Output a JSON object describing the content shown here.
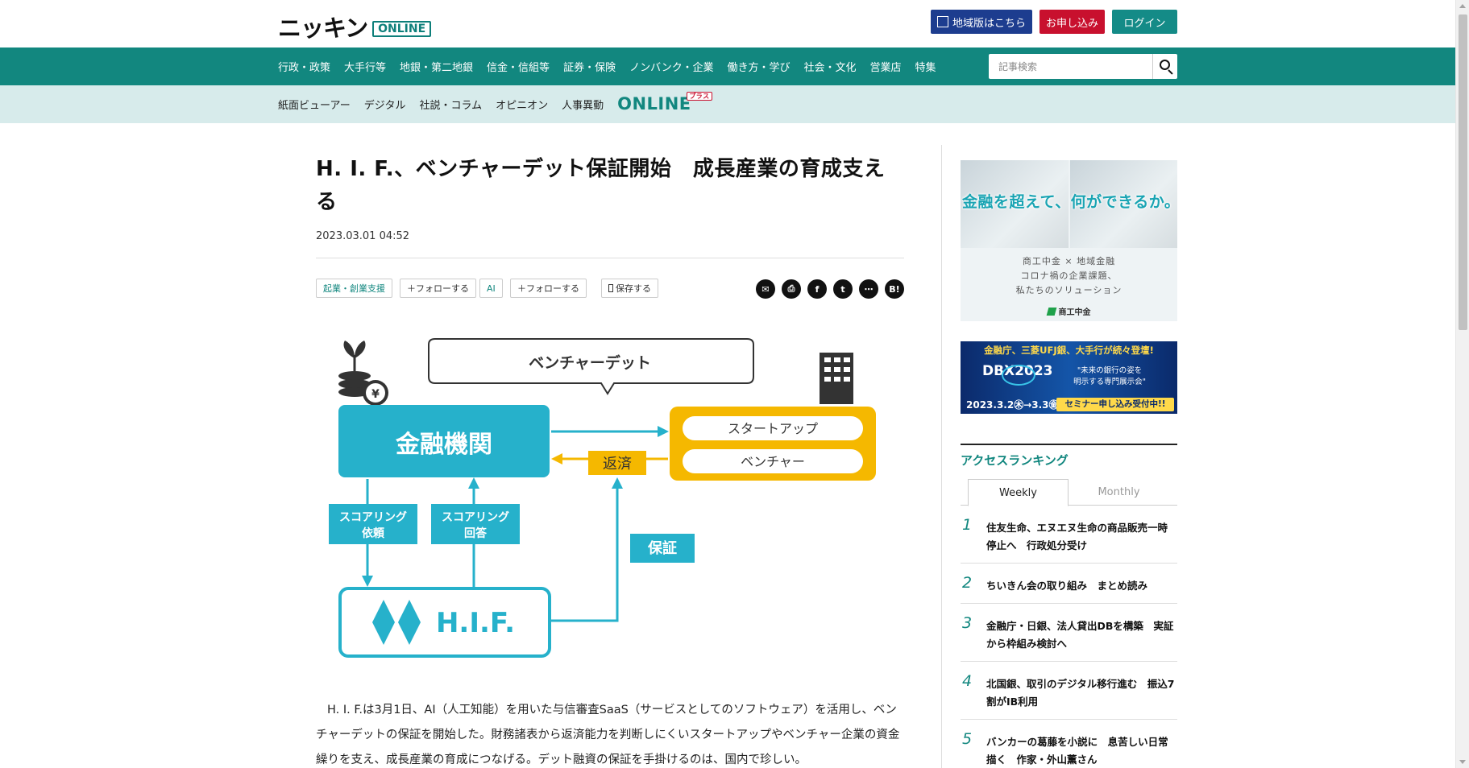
{
  "header": {
    "logo_text": "ニッキン",
    "logo_badge": "ONLINE",
    "region_button": "地域版はこちら",
    "apply_button": "お申し込み",
    "login_button": "ログイン"
  },
  "nav_primary": [
    "行政・政策",
    "大手行等",
    "地銀・第二地銀",
    "信金・信組等",
    "証券・保険",
    "ノンバンク・企業",
    "働き方・学び",
    "社会・文化",
    "営業店",
    "特集"
  ],
  "search": {
    "placeholder": "記事検索"
  },
  "nav_secondary": [
    "紙面ビューアー",
    "デジタル",
    "社説・コラム",
    "オピニオン",
    "人事異動"
  ],
  "nav_online_plus": {
    "label": "ONLINE",
    "badge": "プラス"
  },
  "article": {
    "title": "H. I. F.、ベンチャーデット保証開始　成長産業の育成支える",
    "date": "2023.03.01 04:52",
    "tags": [
      {
        "topic": "起業・創業支援",
        "follow": "＋フォローする"
      },
      {
        "topic": "AI",
        "follow": "＋フォローする"
      }
    ],
    "save_label": "保存する",
    "body": "H. I. F.は3月1日、AI（人工知能）を用いた与信審査SaaS（サービスとしてのソフトウェア）を活用し、ベンチャーデットの保証を開始した。財務諸表から返済能力を判断しにくいスタートアップやベンチャー企業の資金繰りを支え、成長産業の育成につなげる。デット融資の保証を手掛けるのは、国内で珍しい。"
  },
  "diagram": {
    "bubble": "ベンチャーデット",
    "bank": "金融機関",
    "startup": "スタートアップ",
    "venture": "ベンチャー",
    "repay": "返済",
    "scoring_request_1": "スコアリング",
    "scoring_request_2": "依頼",
    "scoring_answer_1": "スコアリング",
    "scoring_answer_2": "回答",
    "guarantee": "保証",
    "hif": "H.I.F.",
    "colors": {
      "blue": "#26b1cb",
      "yellow": "#f5b800",
      "dark": "#333333"
    }
  },
  "sidebar": {
    "ad1": {
      "headline": "金融を超えて、何ができるか。",
      "lines": [
        "商工中金 × 地域金融",
        "コロナ禍の企業課題、",
        "私たちのソリューション"
      ],
      "brand": "商工中金"
    },
    "ad2": {
      "top": "金融庁、三菱UFJ銀、大手行が続々登壇!",
      "logo": "DBX2023",
      "slogan_1": "\"未来の銀行の姿を",
      "slogan_2": "明示する専門展示会\"",
      "date": "2023.3.2㊍→3.3㊎",
      "cta": "セミナー申し込み受付中!!"
    },
    "ranking": {
      "title": "アクセスランキング",
      "tabs": [
        "Weekly",
        "Monthly"
      ],
      "items": [
        {
          "rank": "1",
          "title": "住友生命、エヌエヌ生命の商品販売一時停止へ　行政処分受け"
        },
        {
          "rank": "2",
          "title": "ちいきん会の取り組み　まとめ読み"
        },
        {
          "rank": "3",
          "title": "金融庁・日銀、法人貸出DBを構築　実証から枠組み検討へ"
        },
        {
          "rank": "4",
          "title": "北国銀、取引のデジタル移行進む　振込7割がIB利用"
        },
        {
          "rank": "5",
          "title": "バンカーの葛藤を小説に　息苦しい日常描く　作家・外山薫さん"
        }
      ]
    }
  }
}
